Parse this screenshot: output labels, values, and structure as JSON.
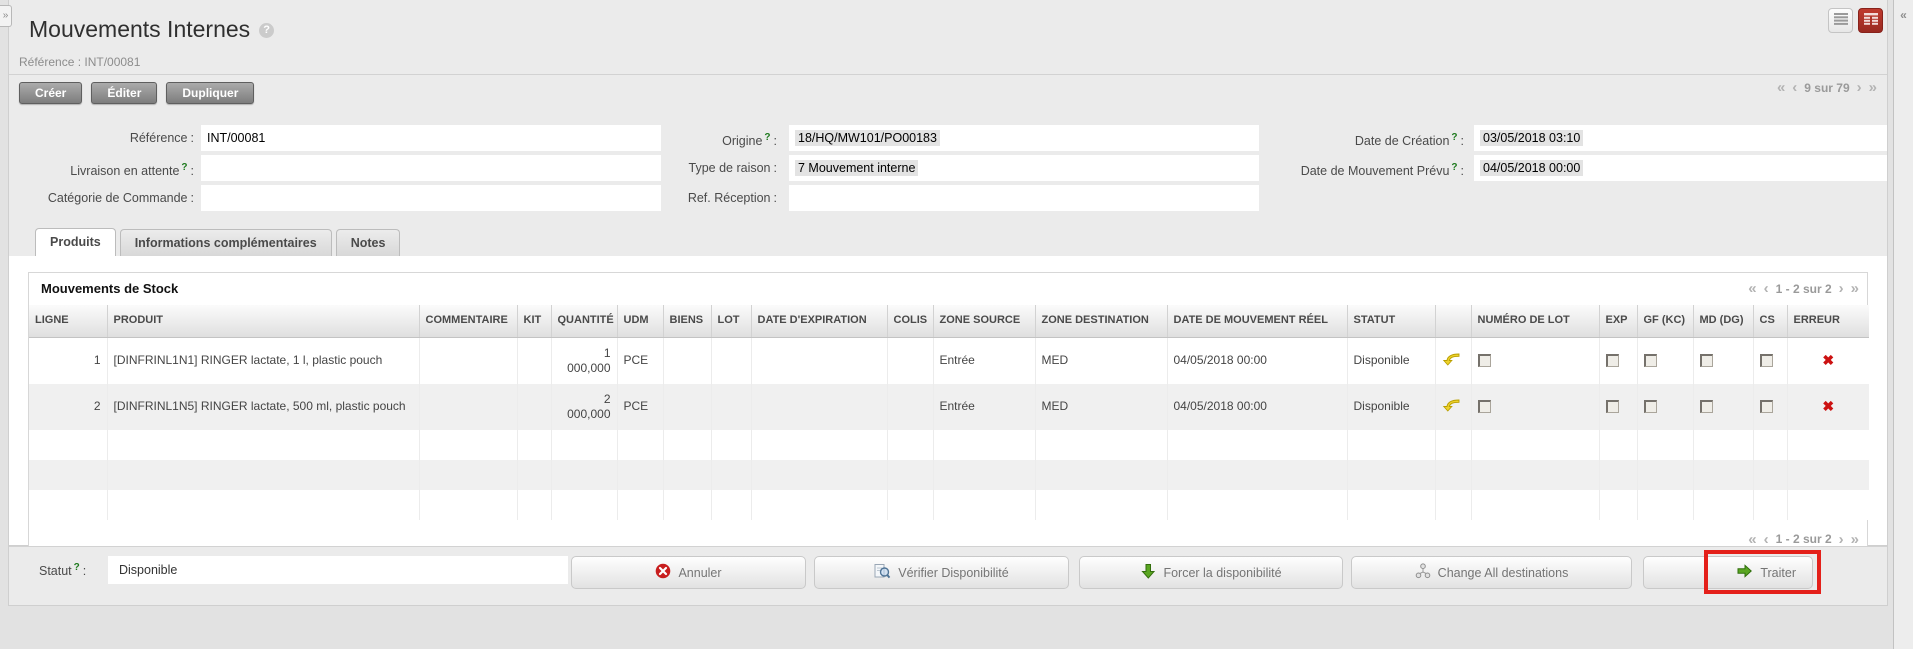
{
  "window": {
    "left_collapse": "»",
    "right_collapse": "«"
  },
  "header": {
    "title": "Mouvements Internes",
    "help": "?",
    "reference_line": "Référence : INT/00081",
    "buttons": {
      "create": "Créer",
      "edit": "Éditer",
      "duplicate": "Dupliquer"
    },
    "pager": {
      "first": "«",
      "prev": "‹",
      "label": "9 sur 79",
      "next": "›",
      "last": "»"
    }
  },
  "form": {
    "reference": {
      "label": "Référence",
      "colon": ":",
      "value": "INT/00081"
    },
    "livraison": {
      "label": "Livraison en attente",
      "help": "?",
      "colon": ":",
      "value": ""
    },
    "categorie": {
      "label": "Catégorie de Commande",
      "colon": ":",
      "value": ""
    },
    "origine": {
      "label": "Origine",
      "help": "?",
      "colon": ":",
      "value": "18/HQ/MW101/PO00183"
    },
    "type_raison": {
      "label": "Type de raison",
      "colon": ":",
      "value": "7 Mouvement interne"
    },
    "ref_reception": {
      "label": "Ref. Réception",
      "colon": ":",
      "value": ""
    },
    "date_creation": {
      "label": "Date de Création",
      "help": "?",
      "colon": ":",
      "value": "03/05/2018 03:10"
    },
    "date_prevu": {
      "label": "Date de Mouvement Prévu",
      "help": "?",
      "colon": ":",
      "value": "04/05/2018 00:00"
    }
  },
  "tabs": {
    "produits": "Produits",
    "infos": "Informations complémentaires",
    "notes": "Notes"
  },
  "grid": {
    "title": "Mouvements de Stock",
    "pager": {
      "first": "«",
      "prev": "‹",
      "label": "1 - 2 sur 2",
      "next": "›",
      "last": "»"
    },
    "columns": [
      "LIGNE",
      "PRODUIT",
      "COMMENTAIRE",
      "KIT",
      "QUANTITÉ",
      "UDM",
      "BIENS",
      "LOT",
      "DATE D'EXPIRATION",
      "COLIS",
      "ZONE SOURCE",
      "ZONE DESTINATION",
      "DATE DE MOUVEMENT RÉEL",
      "STATUT",
      "",
      "NUMÉRO DE LOT",
      "EXP",
      "GF (KC)",
      "MD (DG)",
      "CS",
      "ERREUR"
    ],
    "rows": [
      {
        "ligne": "1",
        "produit": "[DINFRINL1N1] RINGER lactate, 1 l, plastic pouch",
        "quantite": "1 000,000",
        "udm": "PCE",
        "zone_source": "Entrée",
        "zone_destination": "MED",
        "date_mouvement": "04/05/2018 00:00",
        "statut": "Disponible"
      },
      {
        "ligne": "2",
        "produit": "[DINFRINL1N5] RINGER lactate, 500 ml, plastic pouch",
        "quantite": "2 000,000",
        "udm": "PCE",
        "zone_source": "Entrée",
        "zone_destination": "MED",
        "date_mouvement": "04/05/2018 00:00",
        "statut": "Disponible"
      }
    ]
  },
  "footer": {
    "statut": {
      "label": "Statut",
      "help": "?",
      "colon": ":",
      "value": "Disponible"
    },
    "buttons": {
      "annuler": "Annuler",
      "verifier": "Vérifier Disponibilité",
      "forcer": "Forcer la disponibilité",
      "change_all": "Change All destinations",
      "traiter": "Traiter"
    }
  },
  "icons": {
    "error_x": "✖"
  },
  "colors": {
    "form_view_active": "#a32d24",
    "annotation": "#e4201a",
    "action_green": "#5aa621",
    "undo_yellow": "#eed22c"
  }
}
